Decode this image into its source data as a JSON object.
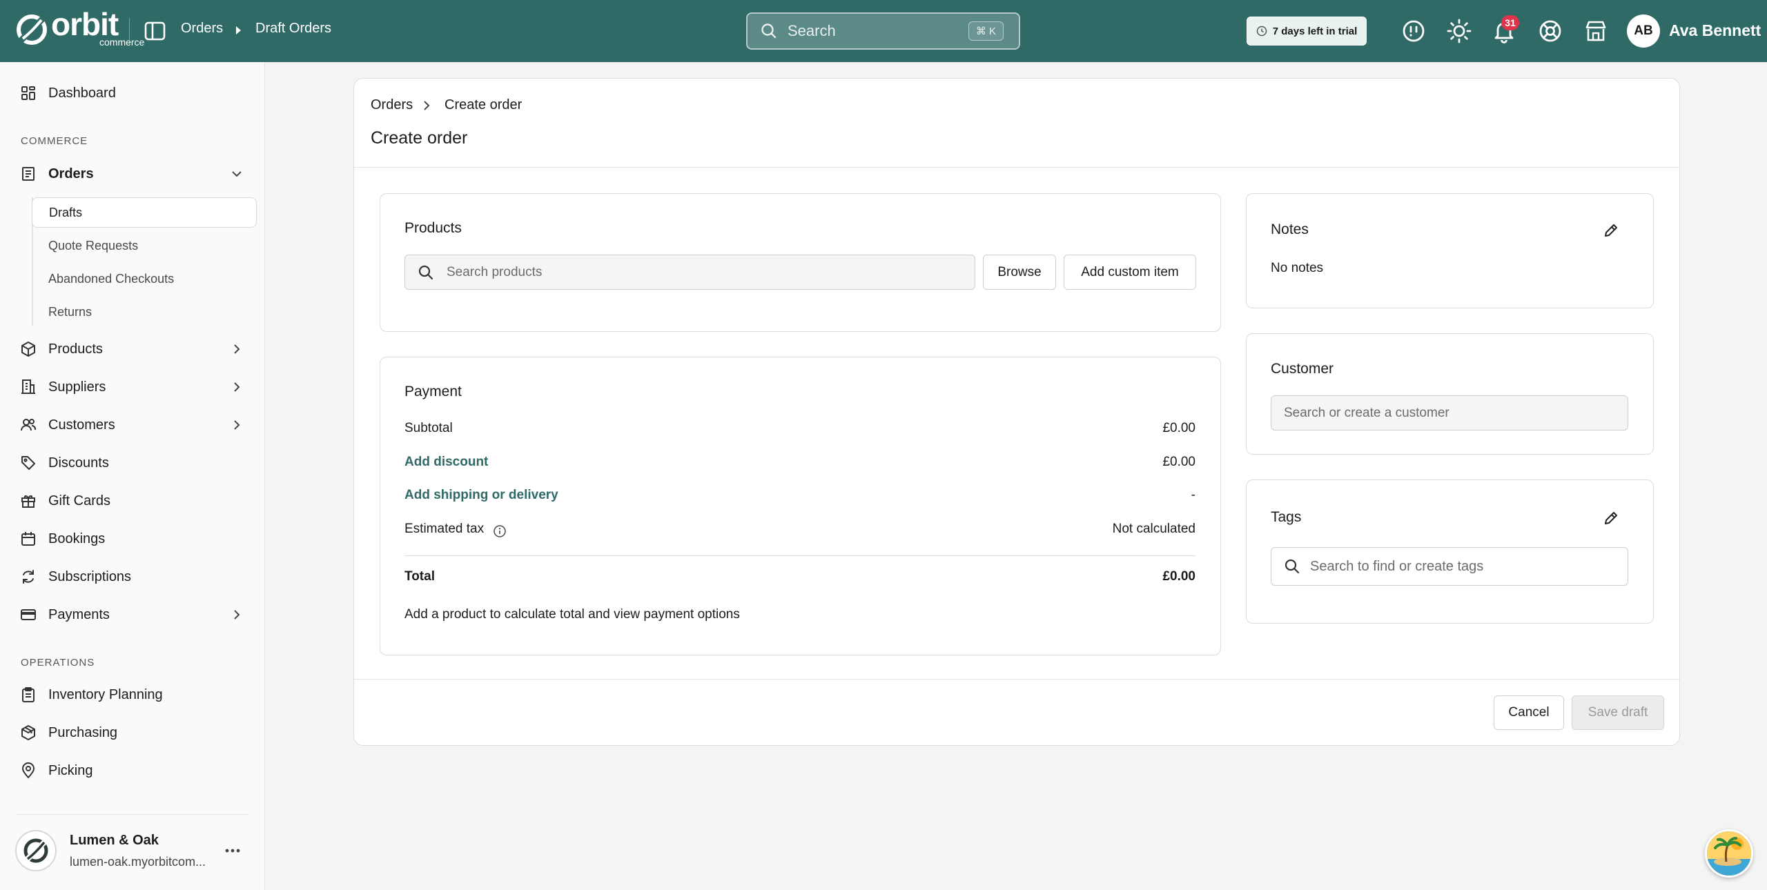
{
  "app": {
    "logo_text": "orbit",
    "logo_sub": "commerce"
  },
  "topbar": {
    "breadcrumb": [
      "Orders",
      "Draft Orders"
    ],
    "search_placeholder": "Search",
    "search_shortcut": "⌘ K",
    "trial_text": "7 days left in trial",
    "notification_count": "31",
    "user_initials": "AB",
    "user_name": "Ava Bennett",
    "icons": [
      "info-icon",
      "sun-icon",
      "bell-icon",
      "help-icon",
      "store-icon"
    ]
  },
  "sidebar": {
    "dashboard": "Dashboard",
    "section_commerce": "COMMERCE",
    "orders": "Orders",
    "order_subitems": [
      "Drafts",
      "Quote Requests",
      "Abandoned Checkouts",
      "Returns"
    ],
    "products": "Products",
    "suppliers": "Suppliers",
    "customers": "Customers",
    "discounts": "Discounts",
    "gift_cards": "Gift Cards",
    "bookings": "Bookings",
    "subscriptions": "Subscriptions",
    "payments": "Payments",
    "section_operations": "OPERATIONS",
    "inventory_planning": "Inventory Planning",
    "purchasing": "Purchasing",
    "picking": "Picking",
    "store_name": "Lumen & Oak",
    "store_url": "lumen-oak.myorbitcom..."
  },
  "main": {
    "breadcrumb_parent": "Orders",
    "breadcrumb_current": "Create order",
    "title": "Create order",
    "products": {
      "title": "Products",
      "search_placeholder": "Search products",
      "browse_label": "Browse",
      "add_custom_label": "Add custom item"
    },
    "payment": {
      "title": "Payment",
      "subtotal_label": "Subtotal",
      "subtotal_value": "£0.00",
      "discount_label": "Add discount",
      "discount_value": "£0.00",
      "shipping_label": "Add shipping or delivery",
      "shipping_value": "-",
      "tax_label": "Estimated tax",
      "tax_value": "Not calculated",
      "total_label": "Total",
      "total_value": "£0.00",
      "hint": "Add a product to calculate total and view payment options"
    },
    "notes": {
      "title": "Notes",
      "empty_text": "No notes"
    },
    "customer": {
      "title": "Customer",
      "placeholder": "Search or create a customer"
    },
    "tags": {
      "title": "Tags",
      "placeholder": "Search to find or create tags"
    },
    "cancel_label": "Cancel",
    "save_label": "Save draft"
  },
  "colors": {
    "brand": "#2f6a66",
    "badge": "#e0334c",
    "link": "#2f6a66"
  }
}
